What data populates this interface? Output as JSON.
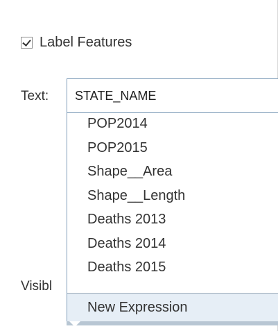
{
  "label_features": {
    "checked": true,
    "label": "Label Features"
  },
  "text_field": {
    "label": "Text:",
    "selected_value": "STATE_NAME"
  },
  "dropdown": {
    "items": [
      "POP2014",
      "POP2015",
      "Shape__Area",
      "Shape__Length",
      "Deaths 2013",
      "Deaths 2014",
      "Deaths 2015"
    ],
    "new_expression": "New Expression"
  },
  "visibility": {
    "label_partial": "Visibl"
  }
}
